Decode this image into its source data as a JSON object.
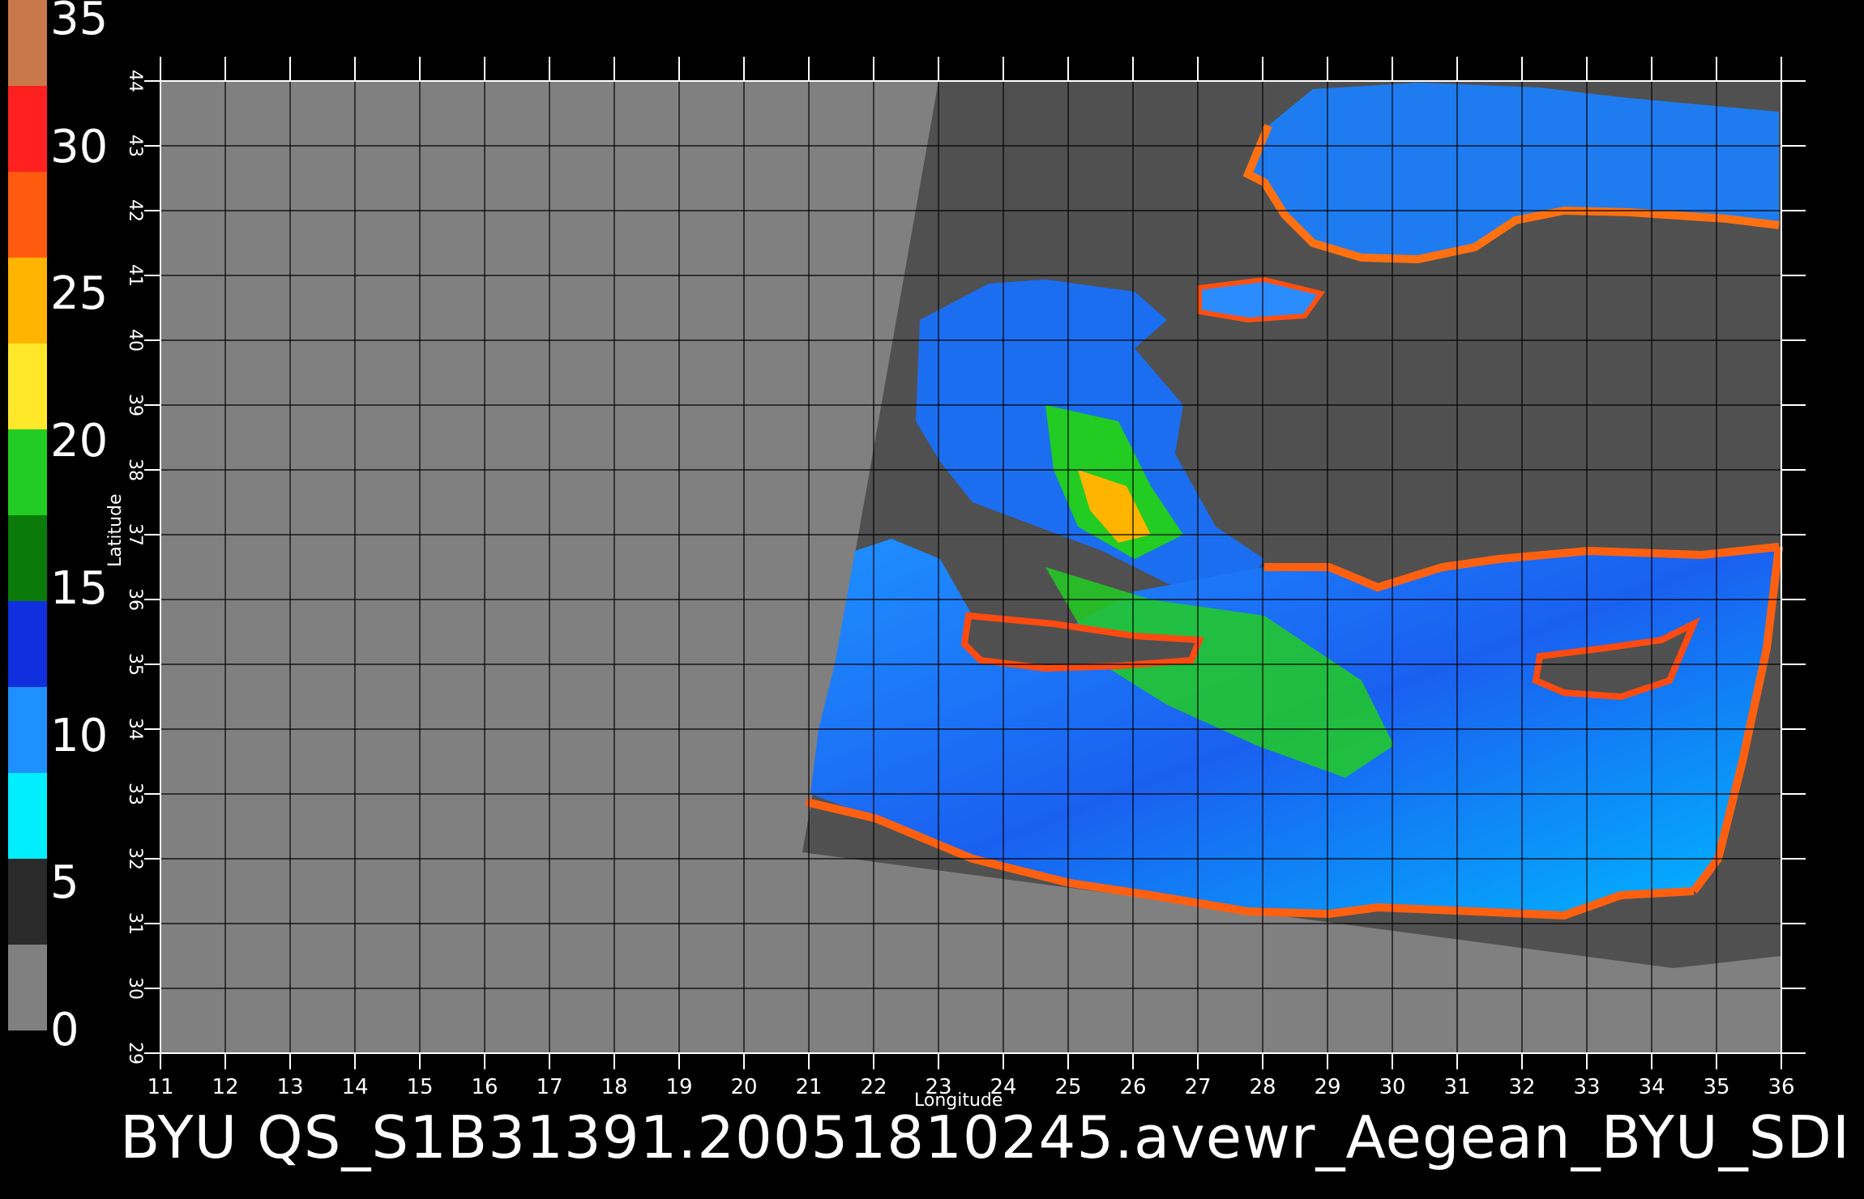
{
  "colorbar": {
    "labels": [
      "35",
      "30",
      "25",
      "20",
      "15",
      "10",
      "5",
      "0"
    ],
    "segments": [
      {
        "color": "#c8784a"
      },
      {
        "color": "#ff2020"
      },
      {
        "color": "#ff5a10"
      },
      {
        "color": "#ffb400"
      },
      {
        "color": "#ffe82a"
      },
      {
        "color": "#22cc22"
      },
      {
        "color": "#0a7a0a"
      },
      {
        "color": "#1030e0"
      },
      {
        "color": "#1e90ff"
      },
      {
        "color": "#00eeff"
      },
      {
        "color": "#2a2a2a"
      },
      {
        "color": "#808080"
      }
    ]
  },
  "map": {
    "land_color": "#808080",
    "nodata_swath_color": "#505050",
    "grid_color": "#000000",
    "lon_ticks": [
      "11",
      "12",
      "13",
      "14",
      "15",
      "16",
      "17",
      "18",
      "19",
      "20",
      "21",
      "22",
      "23",
      "24",
      "25",
      "26",
      "27",
      "28",
      "29",
      "30",
      "31",
      "32",
      "33",
      "34",
      "35",
      "36"
    ],
    "lat_ticks": [
      "29",
      "30",
      "31",
      "32",
      "33",
      "34",
      "35",
      "36",
      "37",
      "38",
      "39",
      "40",
      "41",
      "42",
      "43",
      "44"
    ],
    "xlabel": "Longitude",
    "ylabel": "Latitude"
  },
  "caption": "BYU QS_S1B31391.20051810245.avewr_Aegean_BYU_SDI"
}
